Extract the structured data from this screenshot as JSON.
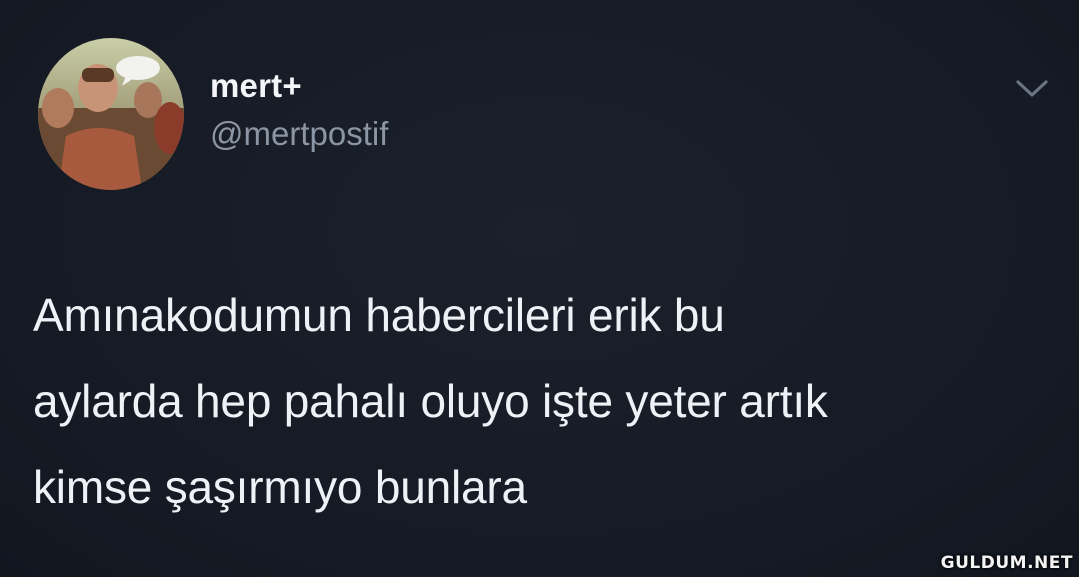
{
  "tweet": {
    "author": {
      "display_name": "mert+",
      "handle": "@mertpostif",
      "avatar_icon": "avatar"
    },
    "menu_icon": "chevron-down-icon",
    "text": "Amınakodumun habercileri erik bu\naylarda hep pahalı oluyo işte yeter artık\nkimse şaşırmıyo bunlara"
  },
  "watermark": "GULDUM.NET",
  "colors": {
    "background": "#151a24",
    "text": "#eef1f5",
    "handle": "#8c95a3",
    "caret": "#6b7482"
  }
}
